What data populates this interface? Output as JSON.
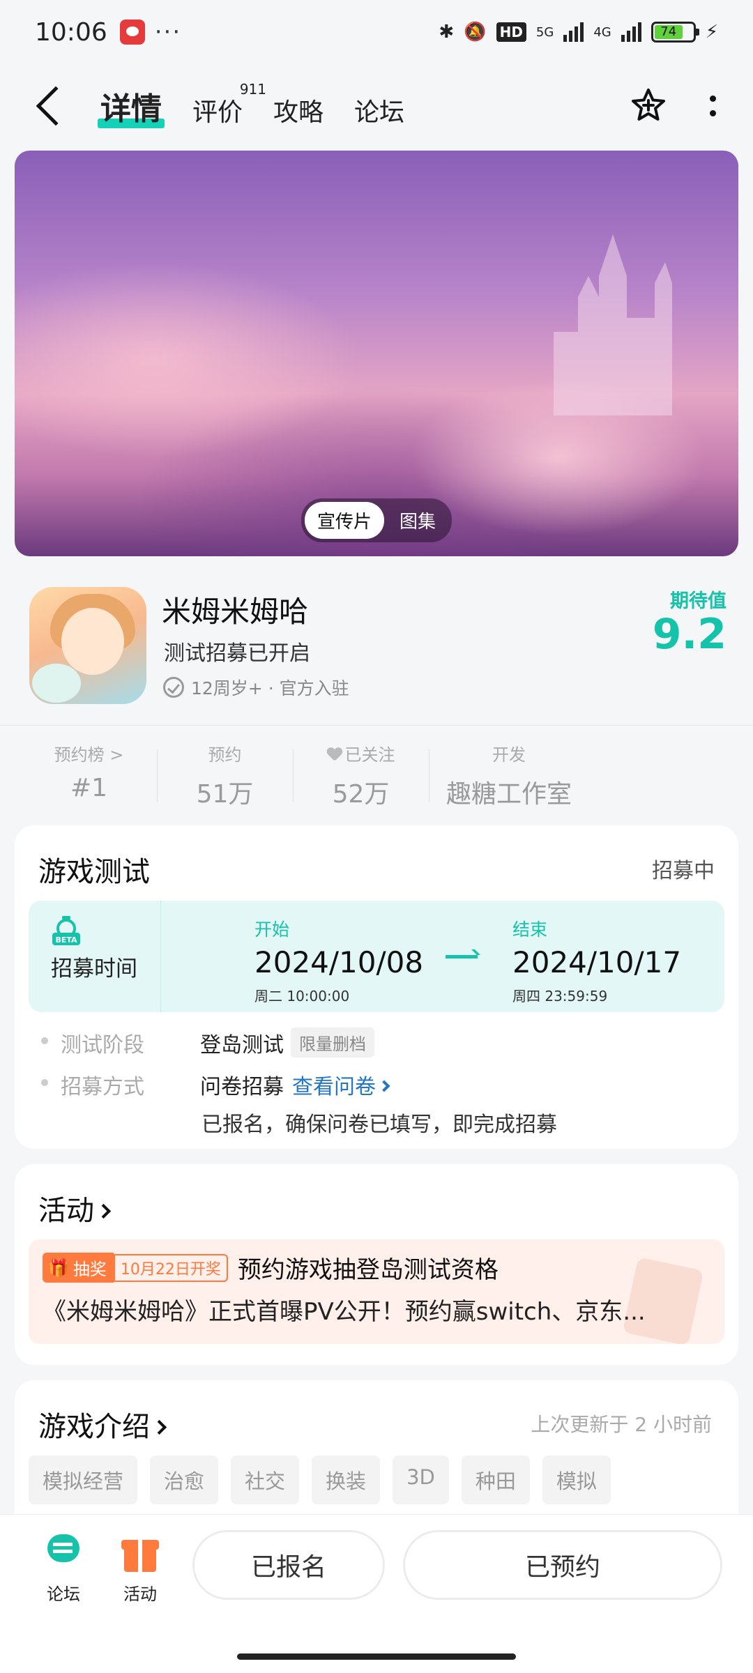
{
  "status": {
    "time": "10:06",
    "dots": "···",
    "hd": "HD",
    "net1": "5G",
    "net2": "4G",
    "battery": "74"
  },
  "nav": {
    "tabs": [
      {
        "label": "详情",
        "badge": ""
      },
      {
        "label": "评价",
        "badge": "911"
      },
      {
        "label": "攻略",
        "badge": ""
      },
      {
        "label": "论坛",
        "badge": ""
      }
    ],
    "active_tab": "详情"
  },
  "banner": {
    "segments": [
      "宣传片",
      "图集"
    ],
    "active_segment": "宣传片"
  },
  "app": {
    "name": "米姆米姆哈",
    "subtitle": "测试招募已开启",
    "meta": "12周岁+ · 官方入驻",
    "expect_label": "期待值",
    "expect_value": "9.2"
  },
  "stats": [
    {
      "label": "预约榜 >",
      "value": "#1"
    },
    {
      "label": "预约",
      "value": "51万"
    },
    {
      "label": "已关注",
      "value": "52万"
    },
    {
      "label": "开发",
      "value": "趣糖工作室"
    }
  ],
  "test": {
    "title": "游戏测试",
    "status": "招募中",
    "recruit_label": "招募时间",
    "start": {
      "label": "开始",
      "date": "2024/10/08",
      "time": "周二  10:00:00"
    },
    "end": {
      "label": "结束",
      "date": "2024/10/17",
      "time": "周四  23:59:59"
    },
    "stage_key": "测试阶段",
    "stage_value": "登岛测试",
    "stage_tag": "限量删档",
    "method_key": "招募方式",
    "method_value": "问卷招募",
    "method_link": "查看问卷",
    "method_note": "已报名，确保问卷已填写，即完成招募"
  },
  "activity": {
    "title": "活动",
    "badge": "抽奖",
    "date_badge": "10月22日开奖",
    "item_title": "预约游戏抽登岛测试资格",
    "item_desc": "《米姆米姆哈》正式首曝PV公开！预约赢switch、京东..."
  },
  "intro": {
    "title": "游戏介绍",
    "updated": "上次更新于 2 小时前",
    "tags": [
      "模拟经营",
      "治愈",
      "社交",
      "换装",
      "3D",
      "种田",
      "模拟"
    ]
  },
  "bottom": {
    "forum_label": "论坛",
    "activity_label": "活动",
    "signup_button": "已报名",
    "reserve_button": "已预约"
  },
  "colors": {
    "accent": "#15c2aa",
    "orange": "#ff7a3d",
    "link": "#2276c7"
  }
}
